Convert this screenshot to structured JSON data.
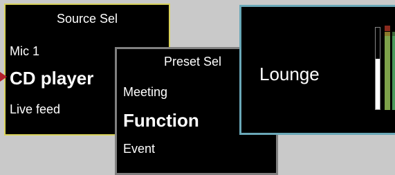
{
  "source_selector": {
    "title": "Source Sel",
    "items": [
      {
        "label": "Mic 1",
        "selected": false
      },
      {
        "label": "CD player",
        "selected": true
      },
      {
        "label": "Live feed",
        "selected": false
      }
    ],
    "border_color": "#d9d25a",
    "pointer_color": "#b3212b"
  },
  "preset_selector": {
    "title": "Preset Sel",
    "items": [
      {
        "label": "Meeting",
        "selected": false
      },
      {
        "label": "Function",
        "selected": true
      },
      {
        "label": "Event",
        "selected": false
      }
    ],
    "border_color": "#808080"
  },
  "zone": {
    "name": "Lounge",
    "border_color": "#6aa8b8",
    "meters": [
      {
        "name": "level-meter",
        "level": 0.62,
        "color": "#ffffff"
      },
      {
        "name": "signal-meter-1",
        "level": 0.88,
        "color": "#7ea24a"
      },
      {
        "name": "signal-meter-2",
        "level": 0.88,
        "color": "#4c9a5c"
      }
    ]
  }
}
